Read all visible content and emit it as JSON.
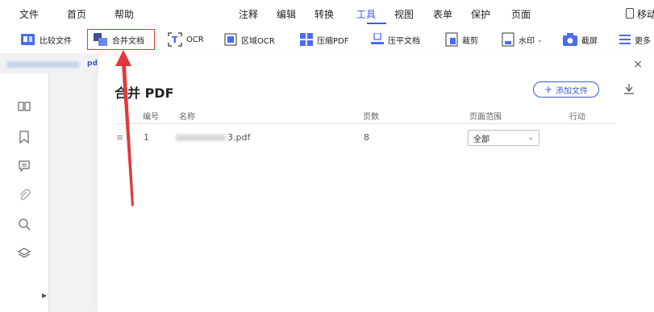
{
  "menubar": {
    "items": [
      "文件",
      "首页",
      "帮助",
      "注释",
      "编辑",
      "转换",
      "工具",
      "视图",
      "表单",
      "保护",
      "页面"
    ],
    "active": "工具",
    "right_label": "移动",
    "accent_color": "#3b5bdb"
  },
  "toolbar": {
    "tools": [
      "比较文件",
      "合并文档",
      "OCR",
      "区域OCR",
      "压缩PDF",
      "压平文档",
      "裁剪",
      "水印",
      "截屏",
      "更多"
    ],
    "highlighted": "合并文档",
    "highlight_color": "#e03a3a"
  },
  "doc_tab": {
    "name_suffix": "pd"
  },
  "sidebar": {
    "icons": [
      "thumbnails-icon",
      "bookmark-icon",
      "comment-icon",
      "attachment-icon",
      "search-icon",
      "layers-icon"
    ]
  },
  "panel": {
    "title": "合并 PDF",
    "add_button": "添加文件",
    "close": "×",
    "columns": [
      "编号",
      "名称",
      "页数",
      "页面范围",
      "行动"
    ],
    "rows": [
      {
        "index": "1",
        "name_suffix": "3.pdf",
        "pages": "8",
        "range": "全部"
      }
    ]
  },
  "annotation": {
    "arrow_color": "#e03a3a"
  }
}
